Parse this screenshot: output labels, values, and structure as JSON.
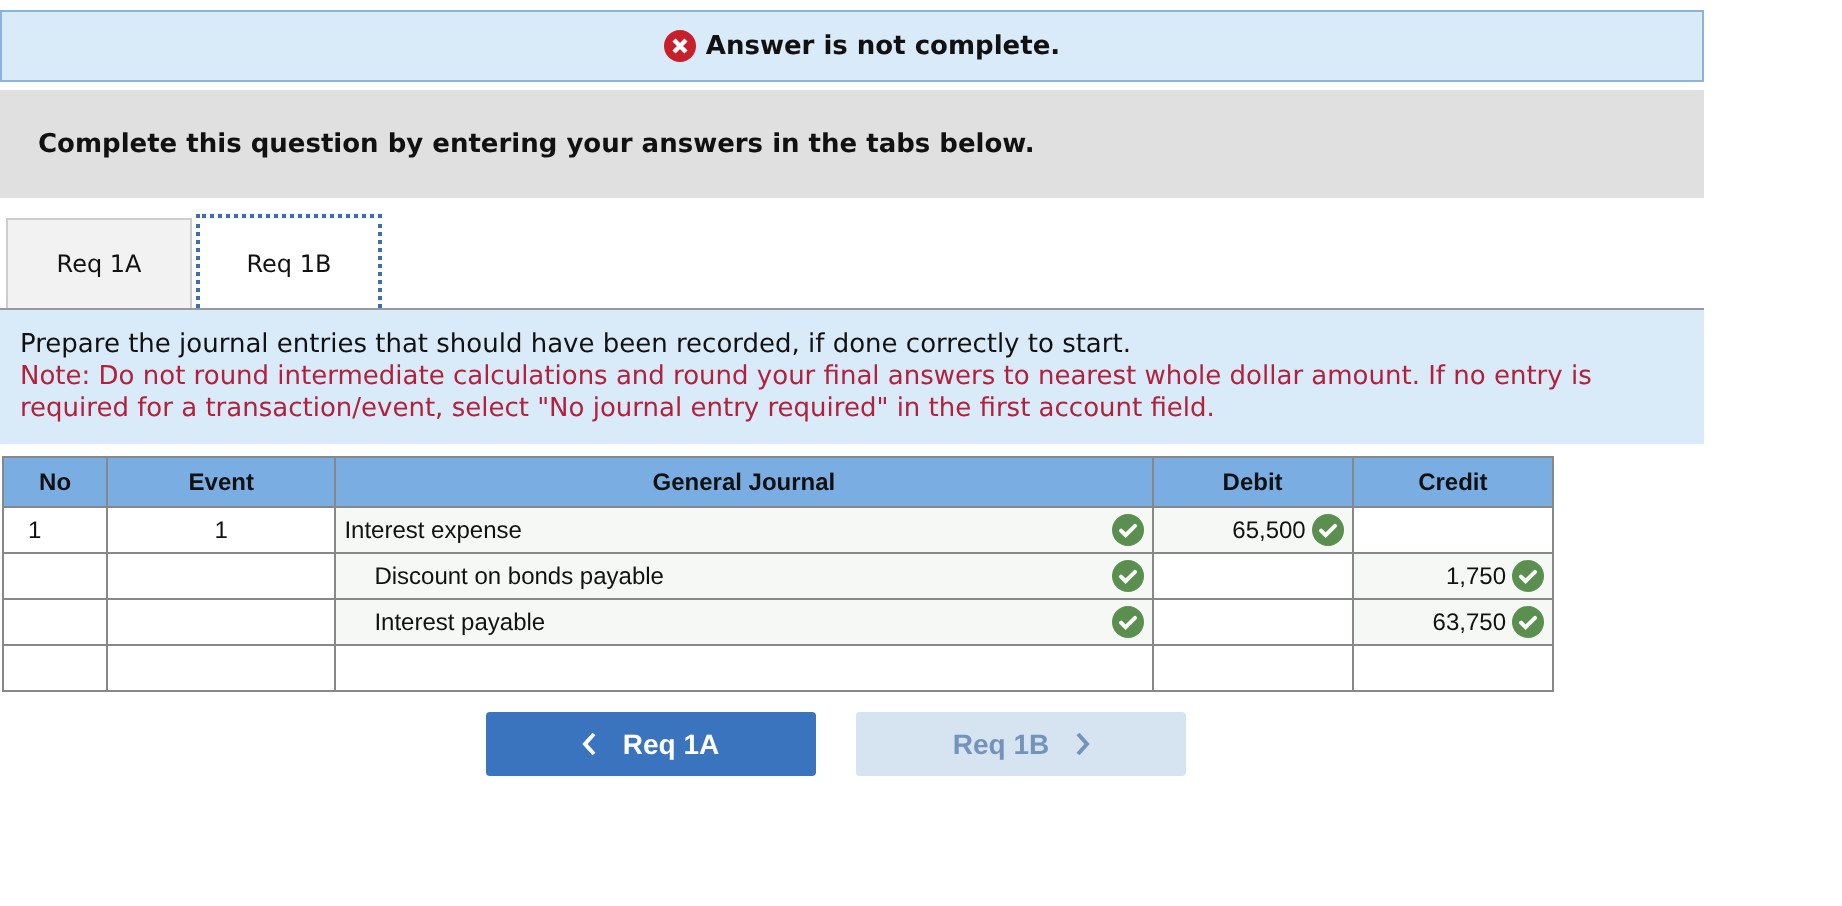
{
  "status_banner": {
    "text": "Answer is not complete.",
    "complete": false
  },
  "instruction": "Complete this question by entering your answers in the tabs below.",
  "tabs": [
    {
      "label": "Req 1A",
      "selected": false
    },
    {
      "label": "Req 1B",
      "selected": true
    }
  ],
  "prompt": {
    "text": "Prepare the journal entries that should have been recorded, if done correctly to start.",
    "note": "Note: Do not round intermediate calculations and round your final answers to nearest whole dollar amount. If no entry is required for a transaction/event, select \"No journal entry required\" in the first account field."
  },
  "table": {
    "columns": [
      "No",
      "Event",
      "General Journal",
      "Debit",
      "Credit"
    ],
    "rows": [
      {
        "no": "1",
        "event": "1",
        "account": "Interest expense",
        "indented": false,
        "account_correct": true,
        "debit": "65,500",
        "debit_correct": true
      },
      {
        "account": "Discount on bonds payable",
        "indented": true,
        "account_correct": true,
        "credit": "1,750",
        "credit_correct": true
      },
      {
        "account": "Interest payable",
        "indented": true,
        "account_correct": true,
        "credit": "63,750",
        "credit_correct": true
      },
      {}
    ]
  },
  "nav": [
    {
      "label": "Req 1A",
      "kind": "prev",
      "disabled": false
    },
    {
      "label": "Req 1B",
      "kind": "next",
      "disabled": true
    }
  ]
}
